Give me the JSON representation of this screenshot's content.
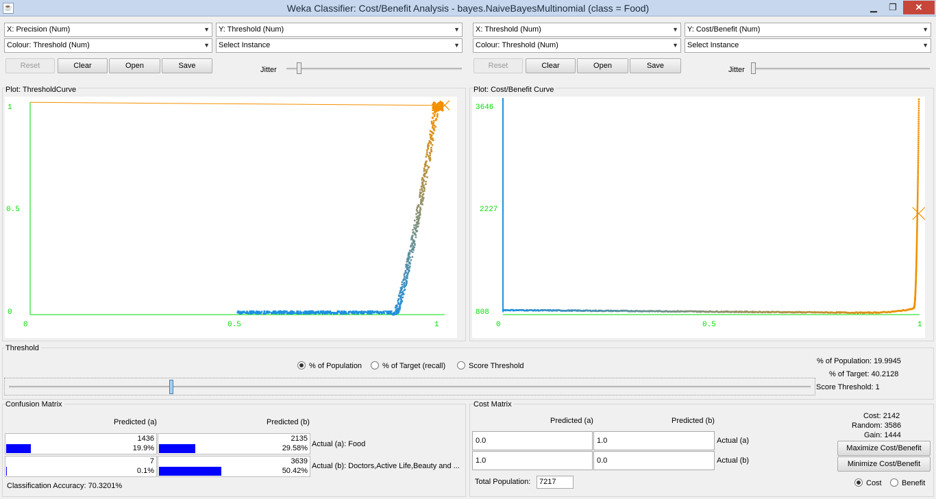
{
  "window": {
    "title": "Weka Classifier: Cost/Benefit Analysis - bayes.NaiveBayesMultinomial  (class = Food)",
    "minimize": "▁",
    "maximize": "❐",
    "close": "✕"
  },
  "left": {
    "x_axis": "X: Precision (Num)",
    "y_axis": "Y: Threshold (Num)",
    "colour": "Colour: Threshold (Num)",
    "select_instance": "Select Instance",
    "buttons": {
      "reset": "Reset",
      "clear": "Clear",
      "open": "Open",
      "save": "Save"
    },
    "jitter_label": "Jitter",
    "plot_title": "Plot: ThresholdCurve",
    "y_ticks": [
      "1",
      "0.5",
      "0"
    ],
    "x_ticks": [
      "0",
      "0.5",
      "1"
    ]
  },
  "right": {
    "x_axis": "X: Threshold (Num)",
    "y_axis": "Y: Cost/Benefit (Num)",
    "colour": "Colour: Threshold (Num)",
    "select_instance": "Select Instance",
    "buttons": {
      "reset": "Reset",
      "clear": "Clear",
      "open": "Open",
      "save": "Save"
    },
    "jitter_label": "Jitter",
    "plot_title": "Plot: Cost/Benefit Curve",
    "y_ticks": [
      "3646",
      "2227",
      "808"
    ],
    "x_ticks": [
      "0",
      "0.5",
      "1"
    ]
  },
  "threshold": {
    "label": "Threshold",
    "options": [
      "% of Population",
      "% of Target (recall)",
      "Score Threshold"
    ],
    "selected": 0,
    "slider_value": 0.2,
    "stats": {
      "population": "% of Population: 19.9945",
      "target": "% of Target: 40.2128",
      "score": "Score Threshold: 1"
    }
  },
  "confusion": {
    "label": "Confusion Matrix",
    "col_a": "Predicted (a)",
    "col_b": "Predicted (b)",
    "cells": [
      {
        "num": "1436",
        "pct": "19.9%",
        "frac": 0.199
      },
      {
        "num": "2135",
        "pct": "29.58%",
        "frac": 0.2958
      },
      {
        "num": "7",
        "pct": "0.1%",
        "frac": 0.001
      },
      {
        "num": "3639",
        "pct": "50.42%",
        "frac": 0.5042
      }
    ],
    "row_a": "Actual (a): Food",
    "row_b": "Actual (b): Doctors,Active Life,Beauty and ...",
    "accuracy": "Classification Accuracy:   70.3201%"
  },
  "cost": {
    "label": "Cost Matrix",
    "col_a": "Predicted (a)",
    "col_b": "Predicted (b)",
    "cells": [
      "0.0",
      "1.0",
      "1.0",
      "0.0"
    ],
    "row_a": "Actual (a)",
    "row_b": "Actual (b)",
    "total_label": "Total Population:",
    "total_value": "7217",
    "summary": {
      "cost": "Cost: 2142",
      "random": "Random: 3586",
      "gain": "Gain: 1444"
    },
    "maximize": "Maximize Cost/Benefit",
    "minimize": "Minimize Cost/Benefit",
    "mode_cost": "Cost",
    "mode_benefit": "Benefit",
    "mode_selected": "cost"
  },
  "colors": {
    "axis": "#00dd00",
    "low": "#1e90e0",
    "high": "#f29000",
    "bar": "#0000ff"
  }
}
